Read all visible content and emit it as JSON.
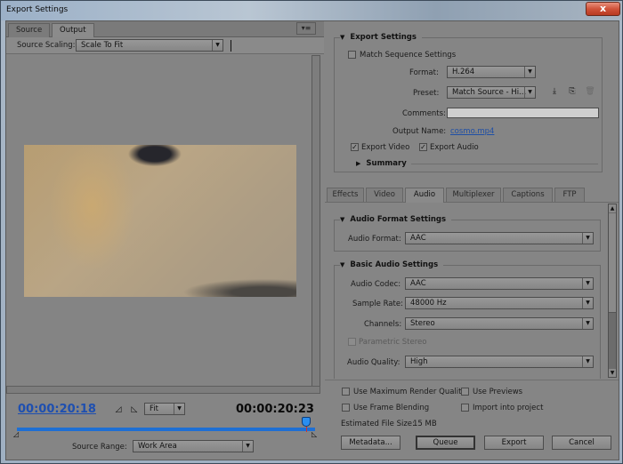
{
  "window": {
    "title": "Export Settings",
    "close_label": "x"
  },
  "left_panel": {
    "tabs": [
      {
        "label": "Source",
        "active": false
      },
      {
        "label": "Output",
        "active": true
      }
    ],
    "panel_menu_icon": "▾≡",
    "source_scaling": {
      "label": "Source Scaling:",
      "value": "Scale To Fit"
    },
    "timecode_current": "00:00:20:18",
    "timecode_total": "00:00:20:23",
    "mark_in_icon": "◿",
    "mark_out_icon": "◺",
    "zoom_dropdown": {
      "value": "Fit"
    },
    "timeline_position": 0.97,
    "source_range": {
      "label": "Source Range:",
      "value": "Work Area"
    }
  },
  "export_settings": {
    "section_title": "Export Settings",
    "match_sequence": {
      "label": "Match Sequence Settings",
      "checked": false
    },
    "format": {
      "label": "Format:",
      "value": "H.264"
    },
    "preset": {
      "label": "Preset:",
      "value": "Match Source - Hi..."
    },
    "preset_icons": {
      "save": "save-preset-icon",
      "import": "import-preset-icon",
      "delete": "delete-preset-icon"
    },
    "comments": {
      "label": "Comments:",
      "value": ""
    },
    "output_name": {
      "label": "Output Name:",
      "value": "cosmo.mp4"
    },
    "export_video": {
      "label": "Export Video",
      "checked": true
    },
    "export_audio": {
      "label": "Export Audio",
      "checked": true
    },
    "summary": {
      "label": "Summary"
    }
  },
  "settings_tabs": [
    {
      "label": "Effects",
      "active": false
    },
    {
      "label": "Video",
      "active": false
    },
    {
      "label": "Audio",
      "active": true
    },
    {
      "label": "Multiplexer",
      "active": false
    },
    {
      "label": "Captions",
      "active": false
    },
    {
      "label": "FTP",
      "active": false
    }
  ],
  "audio": {
    "format_section": "Audio Format Settings",
    "audio_format": {
      "label": "Audio Format:",
      "value": "AAC"
    },
    "basic_section": "Basic Audio Settings",
    "audio_codec": {
      "label": "Audio Codec:",
      "value": "AAC"
    },
    "sample_rate": {
      "label": "Sample Rate:",
      "value": "48000 Hz"
    },
    "channels": {
      "label": "Channels:",
      "value": "Stereo"
    },
    "parametric_stereo": {
      "label": "Parametric Stereo",
      "checked": false,
      "disabled": true
    },
    "audio_quality": {
      "label": "Audio Quality:",
      "value": "High"
    }
  },
  "bottom": {
    "max_render_quality": {
      "label": "Use Maximum Render Quality",
      "checked": false
    },
    "use_previews": {
      "label": "Use Previews",
      "checked": false
    },
    "frame_blending": {
      "label": "Use Frame Blending",
      "checked": false
    },
    "import_project": {
      "label": "Import into project",
      "checked": false
    },
    "file_size_label": "Estimated File Size:",
    "file_size_value": "15 MB",
    "buttons": {
      "metadata": "Metadata...",
      "queue": "Queue",
      "export": "Export",
      "cancel": "Cancel"
    }
  }
}
